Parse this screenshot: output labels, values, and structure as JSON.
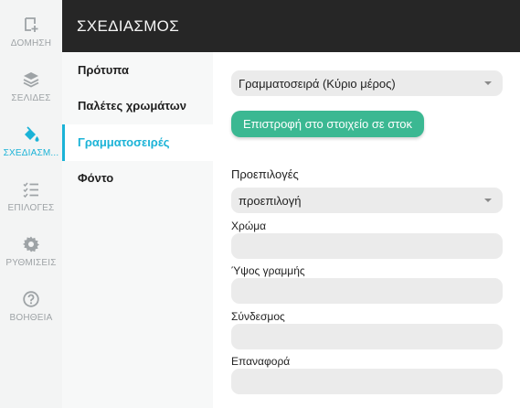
{
  "rail": {
    "items": [
      {
        "label": "ΔΟΜΗΣΗ",
        "icon": "build-plus-icon"
      },
      {
        "label": "ΣΕΛΙΔΕΣ",
        "icon": "layers-icon"
      },
      {
        "label": "ΣΧΕΔΙΑΣΜ...",
        "icon": "paint-bucket-icon"
      },
      {
        "label": "ΕΠΙΛΟΓΕΣ",
        "icon": "checklist-icon"
      },
      {
        "label": "ΡΥΘΜΙΣΕΙΣ",
        "icon": "gear-icon"
      },
      {
        "label": "ΒΟΗΘΕΙΑ",
        "icon": "help-circle-icon"
      }
    ]
  },
  "header": {
    "title": "ΣΧΕΔΙΑΣΜΟΣ"
  },
  "subnav": {
    "items": [
      {
        "label": "Πρότυπα"
      },
      {
        "label": "Παλέτες χρωμάτων"
      },
      {
        "label": "Γραμματοσειρές"
      },
      {
        "label": "Φόντο"
      }
    ]
  },
  "main": {
    "font_select": {
      "value": "Γραμματοσειρά (Κύριο μέρος)"
    },
    "reset_button": {
      "label": "Επιστροφή στο στοιχείο σε στοκ"
    },
    "presets": {
      "label": "Προεπιλογές",
      "value": "προεπιλογή"
    },
    "color": {
      "label": "Χρώμα",
      "value": ""
    },
    "line_height": {
      "label": "Ύψος γραμμής",
      "value": ""
    },
    "link": {
      "label": "Σύνδεσμος",
      "value": ""
    },
    "hover": {
      "label": "Επαναφορά",
      "value": ""
    }
  },
  "colors": {
    "accent": "#1bb3d7",
    "button": "#3bb892",
    "header": "#262626"
  }
}
